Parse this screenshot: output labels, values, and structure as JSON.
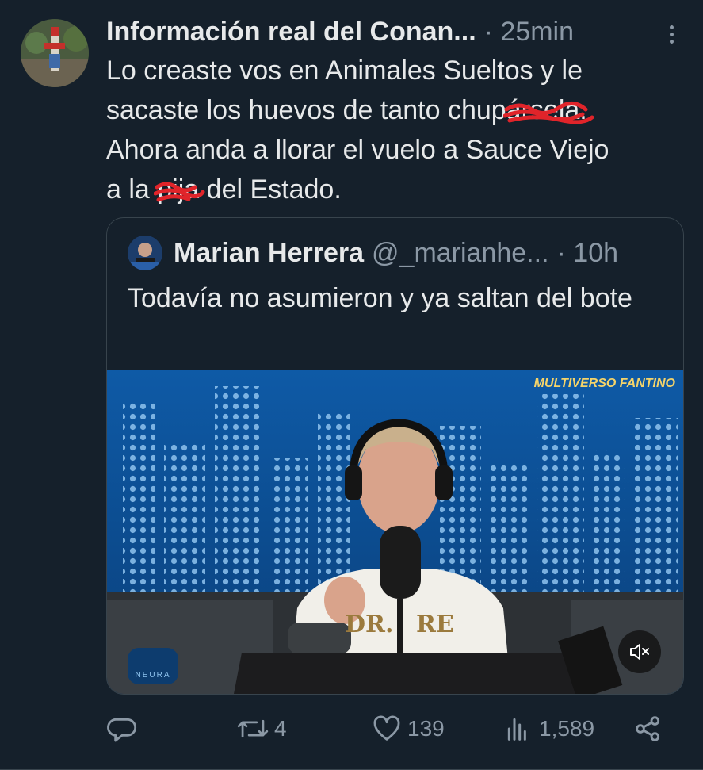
{
  "tweet": {
    "author_name": "Información real del Conan...",
    "time": "· 25min",
    "text_lines": [
      "Lo creaste vos en Animales Sueltos y le",
      "sacaste los huevos de tanto chup",
      "Ahora anda a llorar el vuelo a Sauce Viejo",
      "a la ",
      "del Estado."
    ],
    "text_censored_1_visible": "ársela.",
    "text_censored_2_visible": "pija"
  },
  "quote": {
    "author_name": "Marian Herrera",
    "handle": "@_marianhe...",
    "time": "· 10h",
    "text": "Todavía no asumieron y ya saltan del bote",
    "video": {
      "channel_logo": "MULTIVERSO FANTINO",
      "corner_logo": "NEURA",
      "mute_icon": "volume-muted-icon"
    }
  },
  "actions": {
    "reply_count": "",
    "retweet_count": "4",
    "like_count": "139",
    "views_count": "1,589"
  },
  "colors": {
    "background": "#15202b",
    "text": "#e7e9ea",
    "muted": "#8b98a5",
    "border": "#38444d",
    "scribble": "#e0242a"
  }
}
